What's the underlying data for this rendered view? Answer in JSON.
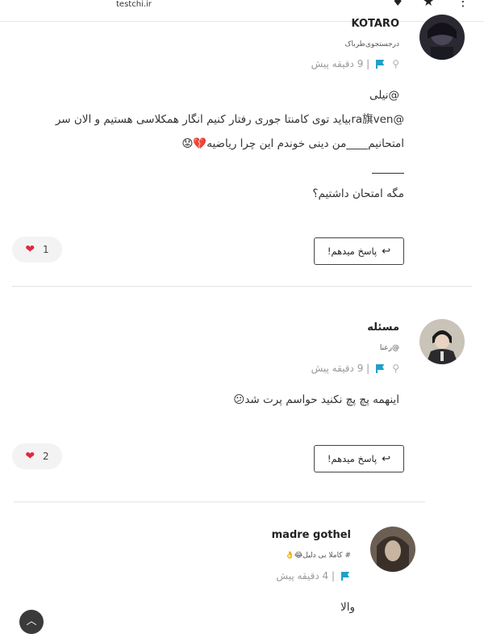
{
  "site": {
    "url": "testchi.ir"
  },
  "comments": [
    {
      "username": "KOTARO",
      "subtitle": "درجستجوی‌طرباک",
      "time": "| 9 دقیقه پیش",
      "lines": [
        "@نیلی",
        "@ra旗venبیاید توی کامنتا جوری رفتار کنیم انگار همکلاسی هستیم و الان سر",
        "امتحانیم____من دینی خوندم این چرا ریاضیه💔😟",
        "مگه امتحان داشتیم؟"
      ],
      "likes": "1",
      "reply_label": "پاسخ میدهم!"
    },
    {
      "username": "مسئله",
      "subtitle": "@رعنا",
      "time": "| 9 دقیقه پیش",
      "lines": [
        "اینهمه پچ پچ نکنید حواسم پرت شد😕"
      ],
      "likes": "2",
      "reply_label": "پاسخ میدهم!"
    },
    {
      "username": "madre gothel",
      "subtitle": "# کاملا بی دلیل😂👌",
      "time": "| 4 دقیقه پیش",
      "lines": [
        "والا"
      ]
    }
  ],
  "colors": {
    "heart": "#e0283c",
    "flag": "#1fa0c8",
    "divider": "#e3e3e3"
  },
  "icons": [
    "pin-icon",
    "flag-icon",
    "heart-icon",
    "reply-icon",
    "scroll-top-icon"
  ]
}
